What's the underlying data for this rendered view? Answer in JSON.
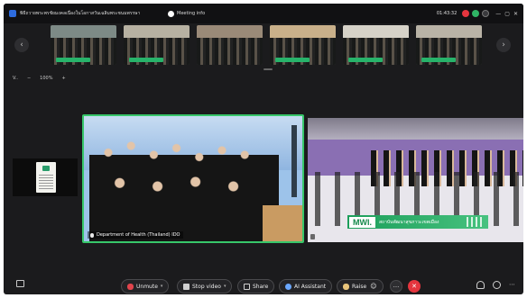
{
  "titlebar": {
    "title": "พิธีถวายพระพรชัยมงคลเนื่องในโอกาสวันเฉลิมพระชนมพรรษา",
    "meeting_info": "Meeting info",
    "timer": "01:43:32"
  },
  "view": {
    "layout_label": "V..",
    "zoom_out": "−",
    "zoom_value": "100%",
    "zoom_in": "+"
  },
  "tiles": {
    "left_name": "Department of Health (Thailand) IDO",
    "right_banner_logo": "MWI.",
    "right_banner_text": "สถาบันพัฒนาสุขภาวะเขตเมือง"
  },
  "toolbar": {
    "unmute": "Unmute",
    "video": "Stop video",
    "share": "Share",
    "ai": "AI Assistant",
    "raise": "Raise",
    "more": "···",
    "end": "✕",
    "chevron": "▾"
  },
  "icons": {
    "nav_prev": "‹",
    "nav_next": "›"
  },
  "colors": {
    "background": "#1b1b1d",
    "end_button": "#e5353e",
    "active_speaker": "#37c76a",
    "banner": "#1c9e5a"
  }
}
